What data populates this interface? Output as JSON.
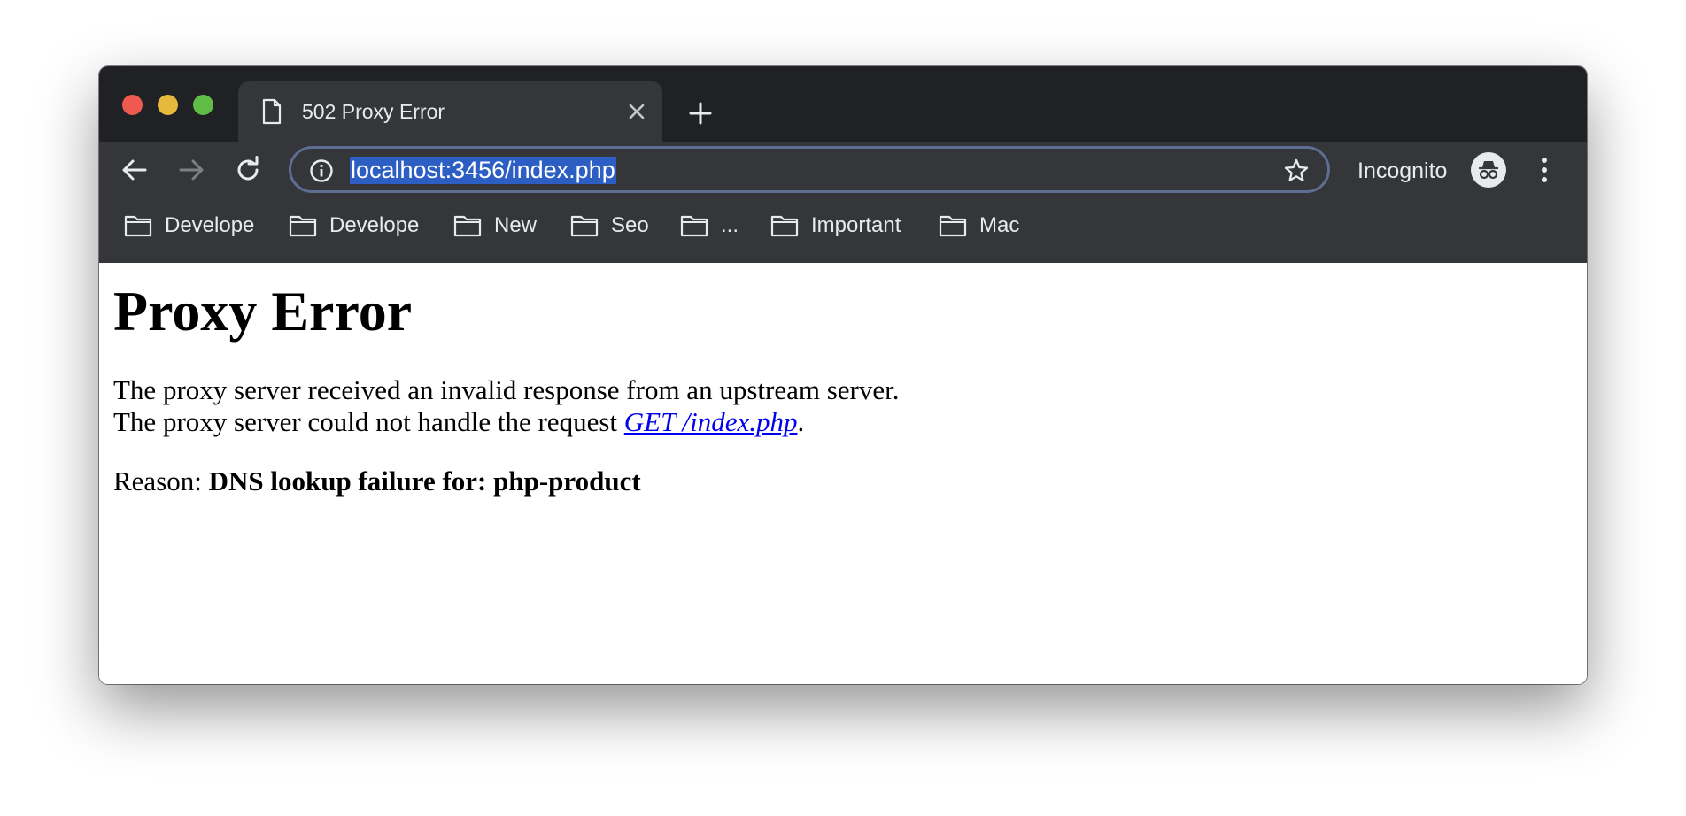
{
  "tab": {
    "title": "502 Proxy Error"
  },
  "toolbar": {
    "url": "localhost:3456/index.php",
    "incognito_label": "Incognito"
  },
  "bookmarks": [
    {
      "label": "Develope",
      "icon": "folder-icon"
    },
    {
      "label": "Develope",
      "icon": "folder-icon"
    },
    {
      "label": "New",
      "icon": "folder-icon"
    },
    {
      "label": "Seo",
      "icon": "folder-icon"
    },
    {
      "label": "...",
      "icon": "folder-icon"
    },
    {
      "label": "Important",
      "icon": "folder-icon"
    },
    {
      "label": "Mac",
      "icon": "folder-icon"
    }
  ],
  "page": {
    "heading": "Proxy Error",
    "line1": "The proxy server received an invalid response from an upstream server.",
    "line2_prefix": "The proxy server could not handle the request ",
    "line2_link": "GET /index.php",
    "line2_suffix": ".",
    "reason_label": "Reason: ",
    "reason_value": "DNS lookup failure for: php-product"
  },
  "colors": {
    "tabstrip_bg": "#202124",
    "toolbar_bg": "#35363a",
    "url_highlight": "#2c5ec4",
    "omnibox_border": "#5f6d92",
    "link": "#0000ee",
    "traffic_close": "#ee5a52",
    "traffic_minimize": "#e6b93d",
    "traffic_maximize": "#5fbd46"
  }
}
